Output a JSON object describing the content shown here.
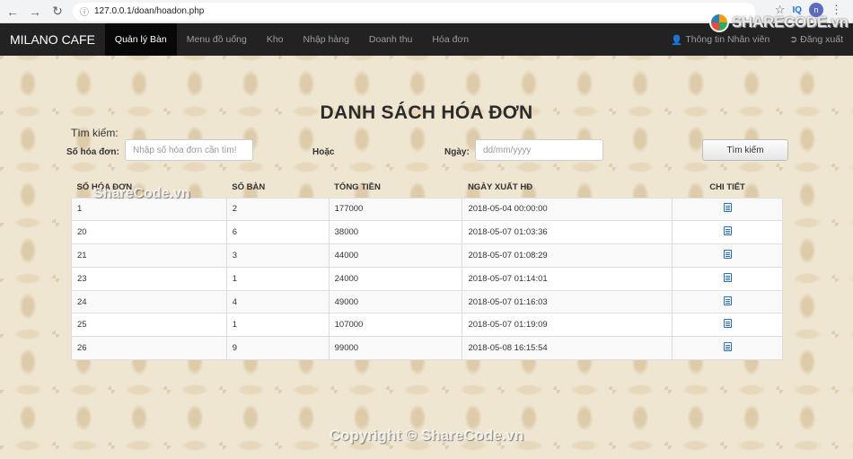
{
  "browser": {
    "url": "127.0.0.1/doan/hoadon.php",
    "profile_initial": "n",
    "extension_label": "IQ"
  },
  "navbar": {
    "brand": "MILANO CAFE",
    "items": [
      {
        "label": "Quản lý Bàn",
        "active": true
      },
      {
        "label": "Menu đồ uống"
      },
      {
        "label": "Kho"
      },
      {
        "label": "Nhập hàng"
      },
      {
        "label": "Doanh thu"
      },
      {
        "label": "Hóa đơn"
      }
    ],
    "staff_info": "Thông tin Nhân viên",
    "logout": "Đăng xuất"
  },
  "page": {
    "title": "DANH SÁCH HÓA ĐƠN"
  },
  "search": {
    "heading": "Tìm kiếm:",
    "invoice_label": "Số hóa đơn:",
    "invoice_placeholder": "Nhập số hóa đơn cần tìm!",
    "or_label": "Hoặc",
    "date_label": "Ngày:",
    "date_placeholder": "dd/mm/yyyy",
    "button": "Tìm kiếm"
  },
  "table": {
    "headers": [
      "SỐ HÓA ĐƠN",
      "SỐ BÀN",
      "TỔNG TIỀN",
      "NGÀY XUẤT HĐ",
      "CHI TIẾT"
    ],
    "rows": [
      {
        "id": "1",
        "table_no": "2",
        "total": "177000",
        "date": "2018-05-04 00:00:00"
      },
      {
        "id": "20",
        "table_no": "6",
        "total": "38000",
        "date": "2018-05-07 01:03:36"
      },
      {
        "id": "21",
        "table_no": "3",
        "total": "44000",
        "date": "2018-05-07 01:08:29"
      },
      {
        "id": "23",
        "table_no": "1",
        "total": "24000",
        "date": "2018-05-07 01:14:01"
      },
      {
        "id": "24",
        "table_no": "4",
        "total": "49000",
        "date": "2018-05-07 01:16:03"
      },
      {
        "id": "25",
        "table_no": "1",
        "total": "107000",
        "date": "2018-05-07 01:19:09"
      },
      {
        "id": "26",
        "table_no": "9",
        "total": "99000",
        "date": "2018-05-08 16:15:54"
      }
    ]
  },
  "watermarks": {
    "logo": "SHARECODE.vn",
    "center": "ShareCode.vn",
    "copyright": "Copyright © ShareCode.vn"
  }
}
